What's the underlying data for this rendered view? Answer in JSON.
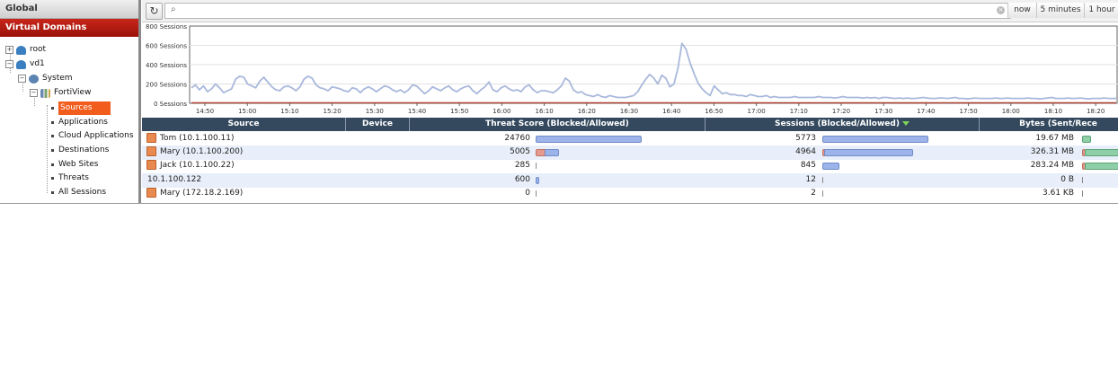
{
  "sidebar": {
    "global_label": "Global",
    "vdom_label": "Virtual Domains",
    "tree": {
      "root": "root",
      "vd1": "vd1",
      "system": "System",
      "fortiview": "FortiView",
      "items": [
        "Sources",
        "Applications",
        "Cloud Applications",
        "Destinations",
        "Web Sites",
        "Threats",
        "All Sessions"
      ]
    }
  },
  "toolbar": {
    "refresh_icon": "refresh-icon",
    "search_value": "",
    "search_placeholder": "",
    "buttons": [
      "now",
      "5 minutes",
      "1 hour"
    ]
  },
  "chart_data": {
    "type": "line",
    "title": "",
    "y_tick_labels": [
      "800 Sessions",
      "600 Sessions",
      "400 Sessions",
      "200 Sessions",
      "0 Sessions"
    ],
    "ylim": [
      0,
      800
    ],
    "x_tick_labels": [
      "14:50",
      "15:00",
      "15:10",
      "15:20",
      "15:30",
      "15:40",
      "15:50",
      "16:00",
      "16:10",
      "16:20",
      "16:30",
      "16:40",
      "16:50",
      "17:00",
      "17:10",
      "17:20",
      "17:30",
      "17:40",
      "17:50",
      "18:00",
      "18:10",
      "18:20"
    ],
    "grid": true,
    "series": [
      {
        "color": "#a9b8dc",
        "values": [
          160,
          190,
          140,
          180,
          120,
          150,
          200,
          160,
          110,
          130,
          150,
          250,
          280,
          270,
          200,
          180,
          160,
          230,
          270,
          220,
          170,
          140,
          130,
          170,
          180,
          160,
          130,
          170,
          250,
          280,
          260,
          190,
          160,
          150,
          130,
          170,
          160,
          150,
          130,
          120,
          160,
          150,
          110,
          150,
          170,
          150,
          120,
          150,
          180,
          170,
          140,
          120,
          140,
          110,
          140,
          190,
          180,
          140,
          100,
          130,
          170,
          150,
          130,
          160,
          180,
          140,
          120,
          150,
          170,
          180,
          130,
          100,
          140,
          170,
          220,
          140,
          120,
          160,
          180,
          150,
          130,
          140,
          120,
          170,
          190,
          140,
          110,
          130,
          130,
          120,
          110,
          140,
          180,
          260,
          230,
          140,
          110,
          120,
          90,
          80,
          70,
          90,
          70,
          60,
          80,
          70,
          60,
          60,
          60,
          70,
          80,
          120,
          190,
          250,
          300,
          260,
          200,
          290,
          260,
          170,
          200,
          360,
          620,
          560,
          420,
          310,
          210,
          150,
          110,
          80,
          180,
          140,
          100,
          110,
          90,
          90,
          80,
          80,
          70,
          90,
          80,
          70,
          70,
          80,
          60,
          70,
          60,
          60,
          60,
          60,
          70,
          60,
          60,
          60,
          60,
          60,
          70,
          60,
          60,
          60,
          55,
          60,
          70,
          60,
          60,
          60,
          60,
          55,
          60,
          55,
          60,
          50,
          60,
          60,
          55,
          50,
          55,
          50,
          55,
          50,
          50,
          55,
          60,
          55,
          50,
          50,
          55,
          55,
          50,
          55,
          60,
          50,
          50,
          45,
          50,
          55,
          50,
          50,
          50,
          50,
          55,
          50,
          50,
          55,
          50,
          50,
          50,
          50,
          55,
          50,
          50,
          45,
          50,
          55,
          60,
          50,
          50,
          50,
          55,
          50,
          50,
          55,
          50,
          45,
          50,
          50,
          50,
          55,
          50,
          50,
          50
        ]
      },
      {
        "color": "#b04030",
        "values": [
          5,
          6,
          5,
          6,
          5,
          5,
          6,
          5,
          5,
          6,
          5,
          6,
          5,
          5,
          6,
          5,
          5,
          6,
          5,
          5,
          6,
          5,
          5,
          6,
          5,
          6,
          5,
          5,
          6,
          5,
          5,
          5,
          6,
          5,
          5,
          6,
          5,
          5,
          5,
          6,
          5,
          5,
          6,
          5,
          5,
          5,
          6,
          5,
          5,
          5,
          6,
          5,
          5,
          5,
          6,
          5,
          5,
          5,
          6,
          5,
          5,
          5
        ]
      }
    ]
  },
  "table": {
    "columns": [
      {
        "label": "Source"
      },
      {
        "label": "Device"
      },
      {
        "label": "Threat Score (Blocked/Allowed)"
      },
      {
        "label": "Sessions (Blocked/Allowed)"
      },
      {
        "label": "Bytes (Sent/Rece"
      }
    ],
    "rows": [
      {
        "source": "Tom (10.1.100.11)",
        "user": true,
        "device": "",
        "threat": "24760",
        "threat_blocked": 0,
        "threat_allowed": 1.0,
        "sessions": "5773",
        "sess_blocked": 0,
        "sess_allowed": 1.0,
        "bytes": "19.67 MB",
        "bytes_sent": 0.2,
        "bytes_recv": 0
      },
      {
        "source": "Mary (10.1.100.200)",
        "user": true,
        "device": "",
        "threat": "5005",
        "threat_blocked": 0.09,
        "threat_allowed": 0.12,
        "sessions": "4964",
        "sess_blocked": 0.02,
        "sess_allowed": 0.84,
        "bytes": "326.31 MB",
        "bytes_sent": 0.05,
        "bytes_recv": 1.0
      },
      {
        "source": "Jack (10.1.100.22)",
        "user": true,
        "device": "",
        "threat": "285",
        "threat_blocked": 0,
        "threat_allowed": 0.01,
        "sessions": "845",
        "sess_blocked": 0,
        "sess_allowed": 0.15,
        "bytes": "283.24 MB",
        "bytes_sent": 0,
        "bytes_recv": 1.0
      },
      {
        "source": "10.1.100.122",
        "user": false,
        "device": "",
        "threat": "600",
        "threat_blocked": 0,
        "threat_allowed": 0.02,
        "sessions": "12",
        "sess_blocked": 0,
        "sess_allowed": 0.005,
        "bytes": "0 B",
        "bytes_sent": 0,
        "bytes_recv": 0
      },
      {
        "source": "Mary (172.18.2.169)",
        "user": true,
        "device": "",
        "threat": "0",
        "threat_blocked": 0,
        "threat_allowed": 0.0,
        "sessions": "2",
        "sess_blocked": 0,
        "sess_allowed": 0.002,
        "bytes": "3.61 KB",
        "bytes_sent": 0,
        "bytes_recv": 0
      }
    ]
  }
}
